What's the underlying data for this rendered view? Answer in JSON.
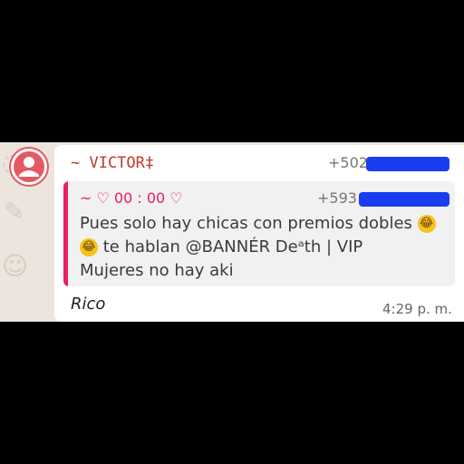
{
  "message": {
    "sender_name": "~ VICTOR‡",
    "sender_phone": "+502",
    "sender_phone_redaction_color": "#1a3df0",
    "quoted": {
      "name": "~ ♡ 00 : 00 ♡",
      "phone": "+593",
      "line1": "Pues solo hay chicas con premios dobles",
      "line2": "te hablan @BANNÉR Deᵃth | VIP",
      "line3": "Mujeres no hay aki",
      "emoji": "rolling-on-floor-laughing-emoji",
      "accent_color": "#e91e63"
    },
    "text": "Rico",
    "time": "4:29 p. m."
  }
}
